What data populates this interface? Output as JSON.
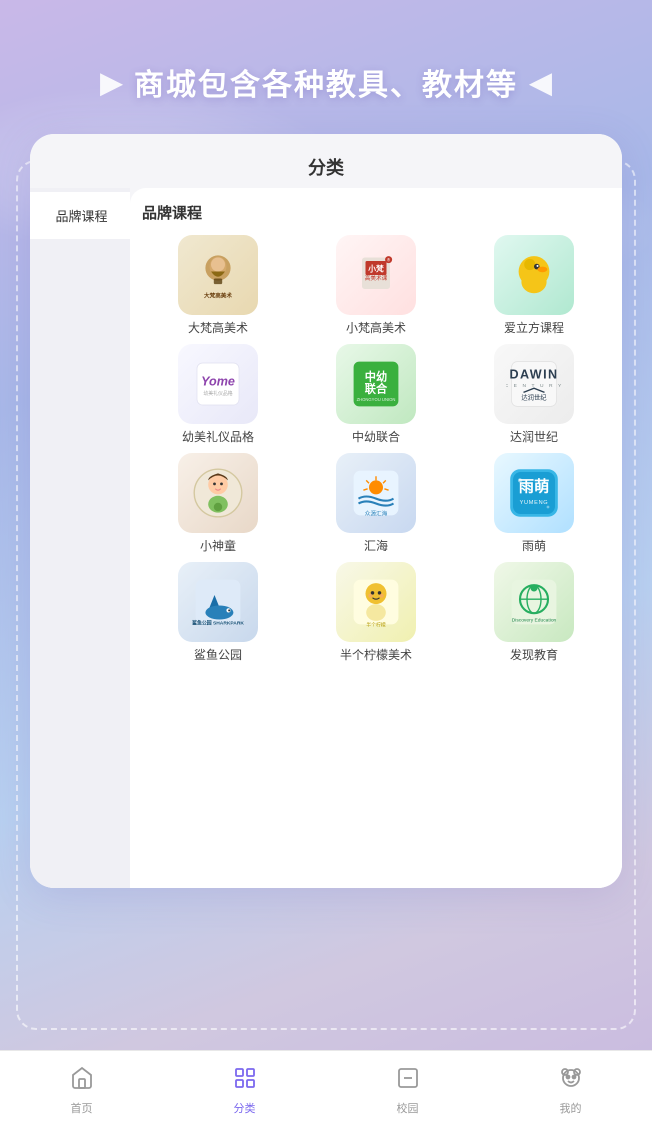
{
  "page": {
    "background_gradient": "linear-gradient(160deg, #c9b8e8, #a8b8e8, #b8d0f0)",
    "title": "分类"
  },
  "banner": {
    "arrow_left": "▶",
    "arrow_right": "◀",
    "text": "商城包含各种教具、教材等"
  },
  "sidebar": {
    "items": [
      {
        "id": "brand",
        "label": "品牌课程",
        "active": true
      }
    ]
  },
  "content": {
    "section_title": "品牌课程",
    "brands": [
      {
        "id": "dafan",
        "label": "大梵高美术",
        "logo_class": "logo-dafan",
        "color": "#8b6914"
      },
      {
        "id": "xiaofan",
        "label": "小梵高美术",
        "logo_class": "logo-xiaofan",
        "color": "#c0392b"
      },
      {
        "id": "ailifang",
        "label": "爱立方课程",
        "logo_class": "logo-ailifang",
        "color": "#16a085"
      },
      {
        "id": "youmei",
        "label": "幼美礼仪品格",
        "logo_class": "logo-youmei",
        "color": "#8e44ad"
      },
      {
        "id": "zhongyou",
        "label": "中幼联合",
        "logo_class": "logo-zhongyou",
        "color": "#27ae60"
      },
      {
        "id": "darun",
        "label": "达润世纪",
        "logo_class": "logo-darun",
        "color": "#2c3e50"
      },
      {
        "id": "xiaoshentong",
        "label": "小神童",
        "logo_class": "logo-xiaoshentong",
        "color": "#e67e22"
      },
      {
        "id": "huihai",
        "label": "汇海",
        "logo_class": "logo-huihai",
        "color": "#2980b9"
      },
      {
        "id": "yumeng",
        "label": "雨萌",
        "logo_class": "logo-yumeng",
        "color": "#2471a3"
      },
      {
        "id": "shayugongyuan",
        "label": "鲨鱼公园",
        "logo_class": "logo-shayugongyuan",
        "color": "#1a5276"
      },
      {
        "id": "bangelemon",
        "label": "半个柠檬美术",
        "logo_class": "logo-bangelemon",
        "color": "#d4ac0d"
      },
      {
        "id": "faxianjy",
        "label": "发现教育",
        "logo_class": "logo-faxianjy",
        "color": "#1e8449"
      }
    ]
  },
  "bottom_nav": {
    "items": [
      {
        "id": "home",
        "label": "首页",
        "active": false,
        "icon": "home"
      },
      {
        "id": "category",
        "label": "分类",
        "active": true,
        "icon": "grid"
      },
      {
        "id": "campus",
        "label": "校园",
        "active": false,
        "icon": "minus-square"
      },
      {
        "id": "mine",
        "label": "我的",
        "active": false,
        "icon": "bear"
      }
    ]
  }
}
